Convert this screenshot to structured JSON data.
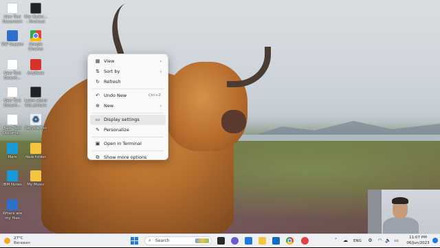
{
  "desktop": {
    "icons": [
      {
        "label": "New Text Document",
        "icon": "text-document-icon"
      },
      {
        "label": "Mar Bydor... - Shortcut",
        "icon": "shortcut-icon"
      },
      {
        "label": "SSP Suspen",
        "icon": "app-icon"
      },
      {
        "label": "Google Chrome",
        "icon": "chrome-icon"
      },
      {
        "label": "New Text Docum...",
        "icon": "text-document-icon"
      },
      {
        "label": "AnyDesk",
        "icon": "anydesk-icon"
      },
      {
        "label": "New Text Docum...",
        "icon": "text-document-icon"
      },
      {
        "label": "Learn about this picture",
        "icon": "camera-icon"
      },
      {
        "label": "New Text Docume...",
        "icon": "text-document-icon"
      },
      {
        "label": "Recycle Bin",
        "icon": "recycle-bin-icon"
      },
      {
        "label": "Mars",
        "icon": "app-icon"
      },
      {
        "label": "New folder",
        "icon": "folder-icon"
      },
      {
        "label": "IBM Notes",
        "icon": "notes-icon"
      },
      {
        "label": "My Music",
        "icon": "music-folder-icon"
      },
      {
        "label": "Where are my files",
        "icon": "info-icon"
      }
    ]
  },
  "context_menu": {
    "items": [
      {
        "label": "View",
        "icon": "grid-icon",
        "submenu": true
      },
      {
        "label": "Sort by",
        "icon": "sort-icon",
        "submenu": true
      },
      {
        "label": "Refresh",
        "icon": "refresh-icon"
      },
      {
        "label": "Undo New",
        "icon": "undo-icon",
        "shortcut": "Ctrl+Z"
      },
      {
        "label": "New",
        "icon": "plus-icon",
        "submenu": true
      },
      {
        "label": "Display settings",
        "icon": "display-icon"
      },
      {
        "label": "Personalize",
        "icon": "brush-icon"
      },
      {
        "label": "Open in Terminal",
        "icon": "terminal-icon"
      },
      {
        "label": "Show more options",
        "icon": "more-options-icon"
      }
    ]
  },
  "taskbar": {
    "weather": {
      "temp": "27°C",
      "condition": "Berawan"
    },
    "search_label": "Search",
    "tray": {
      "language": "ENG"
    },
    "clock": {
      "time": "11:07 PM",
      "date": "06/Jun/2023"
    }
  },
  "colors": {
    "accent": "#1f7ae0",
    "menu_bg": "#f9f9f9",
    "taskbar_bg": "#eef0f4"
  }
}
